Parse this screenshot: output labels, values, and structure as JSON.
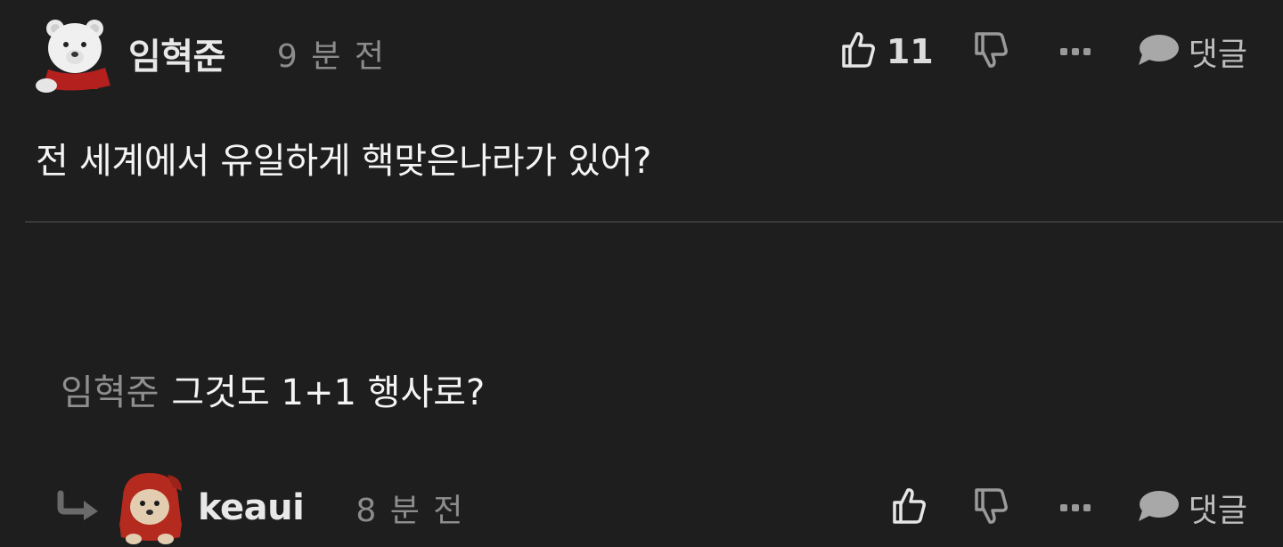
{
  "comments": [
    {
      "username": "임혁준",
      "time": "9 분 전",
      "likes": "11",
      "reply_label": "댓글",
      "text": "전 세계에서 유일하게 핵맞은나라가 있어?",
      "avatar": "polar-bear-avatar"
    },
    {
      "username": "keaui",
      "time": "8 분 전",
      "likes": "",
      "reply_label": "댓글",
      "mention": "임혁준",
      "text": "그것도 1+1 행사로?",
      "avatar": "puppy-red-hood-avatar"
    }
  ],
  "icons": {
    "like": "thumbs-up-icon",
    "dislike": "thumbs-down-icon",
    "more": "more-dots-icon",
    "reply": "speech-bubble-icon",
    "reply_arrow": "reply-arrow-icon"
  },
  "colors": {
    "background": "#1e1e1e",
    "text": "#f4f4f4",
    "muted": "#8c8c8c",
    "divider": "#3a3a3a"
  }
}
